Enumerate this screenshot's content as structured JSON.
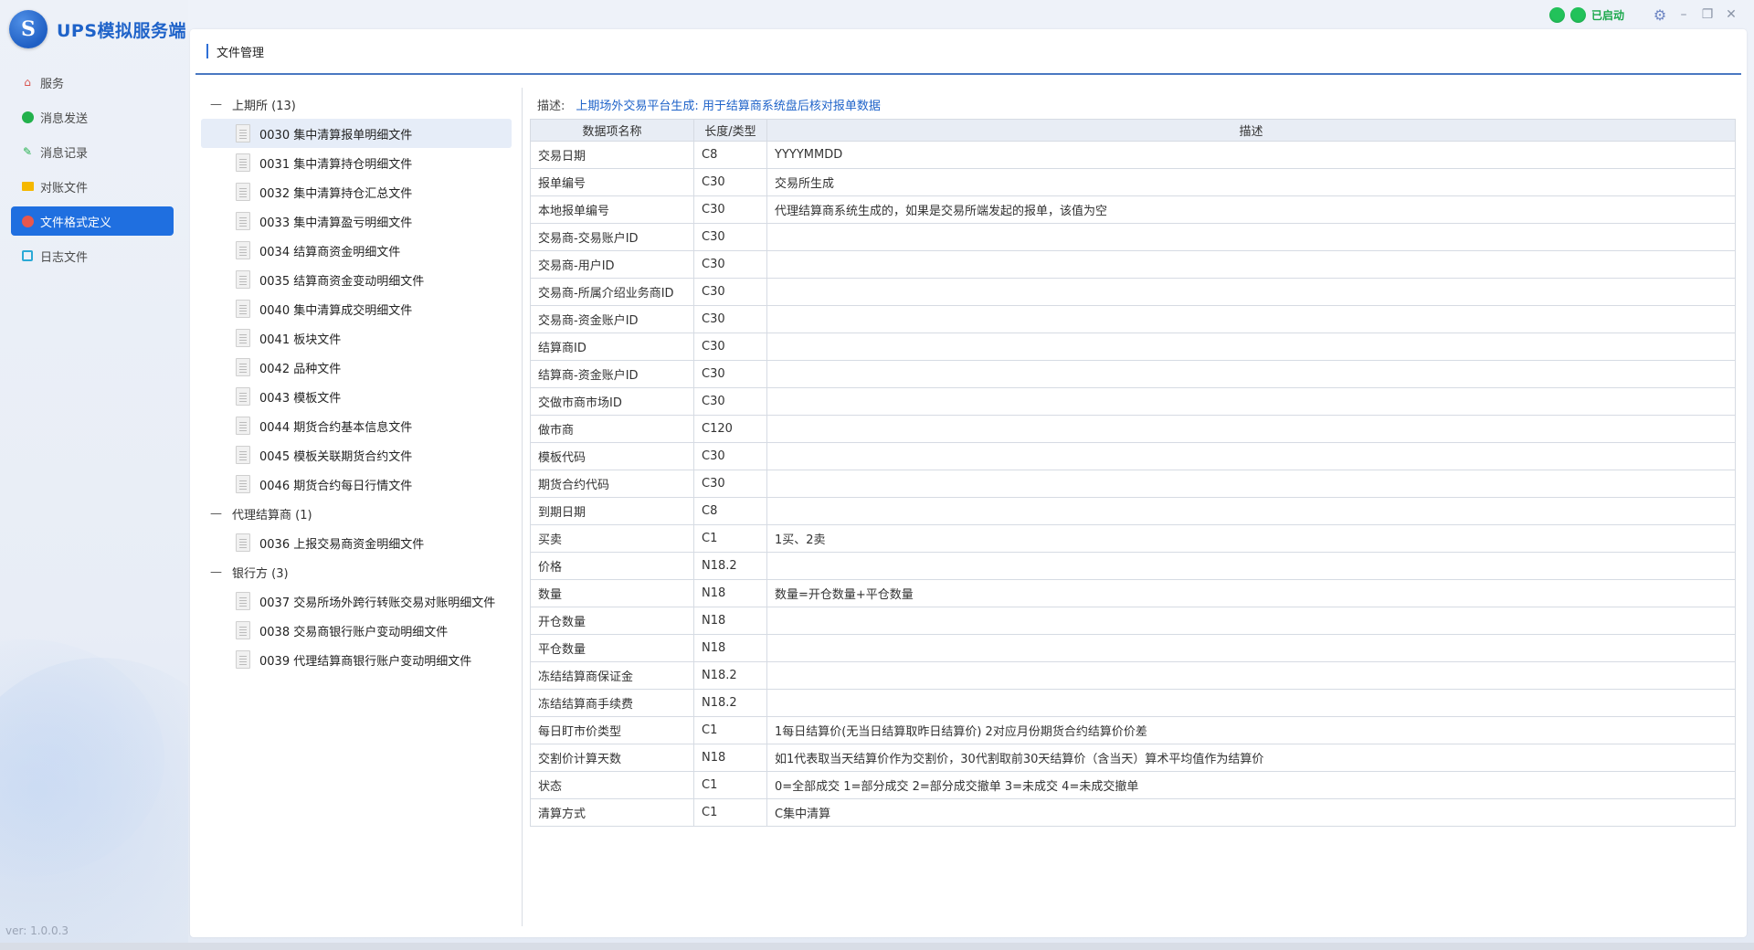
{
  "app": {
    "title": "UPS模拟服务端",
    "version": "ver: 1.0.0.3",
    "logo_letter": "S"
  },
  "status": {
    "label": "已启动"
  },
  "sidebar": {
    "items": [
      {
        "label": "服务",
        "icon": "home-icon",
        "active": false
      },
      {
        "label": "消息发送",
        "icon": "chat-icon",
        "active": false
      },
      {
        "label": "消息记录",
        "icon": "record-icon",
        "active": false
      },
      {
        "label": "对账文件",
        "icon": "folder-icon",
        "active": false
      },
      {
        "label": "文件格式定义",
        "icon": "format-icon",
        "active": true
      },
      {
        "label": "日志文件",
        "icon": "log-icon",
        "active": false
      }
    ]
  },
  "main": {
    "title": "文件管理"
  },
  "tree": [
    {
      "label": "上期所 (13)",
      "children": [
        "0030 集中清算报单明细文件",
        "0031 集中清算持仓明细文件",
        "0032 集中清算持仓汇总文件",
        "0033 集中清算盈亏明细文件",
        "0034 结算商资金明细文件",
        "0035 结算商资金变动明细文件",
        "0040 集中清算成交明细文件",
        "0041 板块文件",
        "0042 品种文件",
        "0043 模板文件",
        "0044 期货合约基本信息文件",
        "0045 模板关联期货合约文件",
        "0046 期货合约每日行情文件"
      ]
    },
    {
      "label": "代理结算商 (1)",
      "children": [
        "0036 上报交易商资金明细文件"
      ]
    },
    {
      "label": "银行方 (3)",
      "children": [
        "0037 交易所场外跨行转账交易对账明细文件",
        "0038 交易商银行账户变动明细文件",
        "0039 代理结算商银行账户变动明细文件"
      ]
    }
  ],
  "detail": {
    "desc_label": "描述:",
    "desc_value": "上期场外交易平台生成: 用于结算商系统盘后核对报单数据",
    "columns": [
      "数据项名称",
      "长度/类型",
      "描述"
    ],
    "rows": [
      [
        "交易日期",
        "C8",
        "YYYYMMDD"
      ],
      [
        "报单编号",
        "C30",
        "交易所生成"
      ],
      [
        "本地报单编号",
        "C30",
        "代理结算商系统生成的，如果是交易所端发起的报单，该值为空"
      ],
      [
        "交易商-交易账户ID",
        "C30",
        ""
      ],
      [
        "交易商-用户ID",
        "C30",
        ""
      ],
      [
        "交易商-所属介绍业务商ID",
        "C30",
        ""
      ],
      [
        "交易商-资金账户ID",
        "C30",
        ""
      ],
      [
        "结算商ID",
        "C30",
        ""
      ],
      [
        "结算商-资金账户ID",
        "C30",
        ""
      ],
      [
        "交做市商市场ID",
        "C30",
        ""
      ],
      [
        "做市商",
        "C120",
        ""
      ],
      [
        "模板代码",
        "C30",
        ""
      ],
      [
        "期货合约代码",
        "C30",
        ""
      ],
      [
        "到期日期",
        "C8",
        ""
      ],
      [
        "买卖",
        "C1",
        "1买、2卖"
      ],
      [
        "价格",
        "N18.2",
        ""
      ],
      [
        "数量",
        "N18",
        "数量=开仓数量+平仓数量"
      ],
      [
        "开仓数量",
        "N18",
        ""
      ],
      [
        "平仓数量",
        "N18",
        ""
      ],
      [
        "冻结结算商保证金",
        "N18.2",
        ""
      ],
      [
        "冻结结算商手续费",
        "N18.2",
        ""
      ],
      [
        "每日盯市价类型",
        "C1",
        "1每日结算价(无当日结算取昨日结算价) 2对应月份期货合约结算价价差"
      ],
      [
        "交割价计算天数",
        "N18",
        "如1代表取当天结算价作为交割价，30代割取前30天结算价（含当天）算术平均值作为结算价"
      ],
      [
        "状态",
        "C1",
        "0=全部成交   1=部分成交   2=部分成交撤单                3=未成交       4=未成交撤单"
      ],
      [
        "清算方式",
        "C1",
        "C集中清算"
      ]
    ]
  }
}
